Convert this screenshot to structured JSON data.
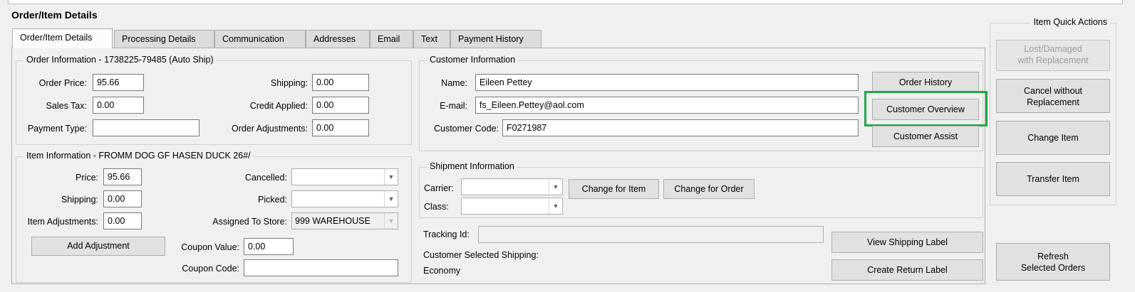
{
  "page": {
    "title": "Order/Item Details"
  },
  "tabs": [
    {
      "label": "Order/Item Details",
      "active": true
    },
    {
      "label": "Processing Details"
    },
    {
      "label": "Communication"
    },
    {
      "label": "Addresses"
    },
    {
      "label": "Email"
    },
    {
      "label": "Text"
    },
    {
      "label": "Payment History"
    }
  ],
  "order_info": {
    "legend": "Order Information - 1738225-79485 (Auto Ship)",
    "order_price_label": "Order Price:",
    "order_price": "95.66",
    "sales_tax_label": "Sales Tax:",
    "sales_tax": "0.00",
    "payment_type_label": "Payment Type:",
    "payment_type": "",
    "shipping_label": "Shipping:",
    "shipping": "0.00",
    "credit_applied_label": "Credit Applied:",
    "credit_applied": "0.00",
    "order_adjustments_label": "Order Adjustments:",
    "order_adjustments": "0.00"
  },
  "item_info": {
    "legend": "Item Information - FROMM DOG GF HASEN DUCK 26#/",
    "price_label": "Price:",
    "price": "95.66",
    "shipping_label": "Shipping:",
    "shipping": "0.00",
    "item_adjustments_label": "Item Adjustments:",
    "item_adjustments": "0.00",
    "cancelled_label": "Cancelled:",
    "cancelled": "",
    "picked_label": "Picked:",
    "picked": "",
    "assigned_store_label": "Assigned To Store:",
    "assigned_store": "999 WAREHOUSE",
    "add_adjustment_label": "Add Adjustment",
    "coupon_value_label": "Coupon Value:",
    "coupon_value": "0.00",
    "coupon_code_label": "Coupon Code:",
    "coupon_code": ""
  },
  "customer_info": {
    "legend": "Customer Information",
    "name_label": "Name:",
    "name": "Eileen Pettey",
    "email_label": "E-mail:",
    "email": "fs_Eileen.Pettey@aol.com",
    "code_label": "Customer Code:",
    "code": "F0271987",
    "order_history_label": "Order History",
    "customer_overview_label": "Customer Overview",
    "customer_assist_label": "Customer Assist",
    "highlight_color": "#22a84a"
  },
  "shipment_info": {
    "legend": "Shipment Information",
    "carrier_label": "Carrier:",
    "carrier": "",
    "class_label": "Class:",
    "class": "",
    "change_for_item_label": "Change for Item",
    "change_for_order_label": "Change for Order",
    "tracking_label": "Tracking Id:",
    "tracking": "",
    "customer_selected_shipping_label": "Customer Selected Shipping:",
    "customer_selected_shipping": "Economy",
    "view_shipping_label": "View Shipping Label",
    "create_return_label": "Create Return Label"
  },
  "quick_actions": {
    "legend": "Item Quick Actions",
    "lost_damaged_line1": "Lost/Damaged",
    "lost_damaged_line2": "with Replacement",
    "cancel_line1": "Cancel without",
    "cancel_line2": "Replacement",
    "change_item": "Change Item",
    "transfer_item": "Transfer Item",
    "refresh_line1": "Refresh",
    "refresh_line2": "Selected Orders"
  }
}
